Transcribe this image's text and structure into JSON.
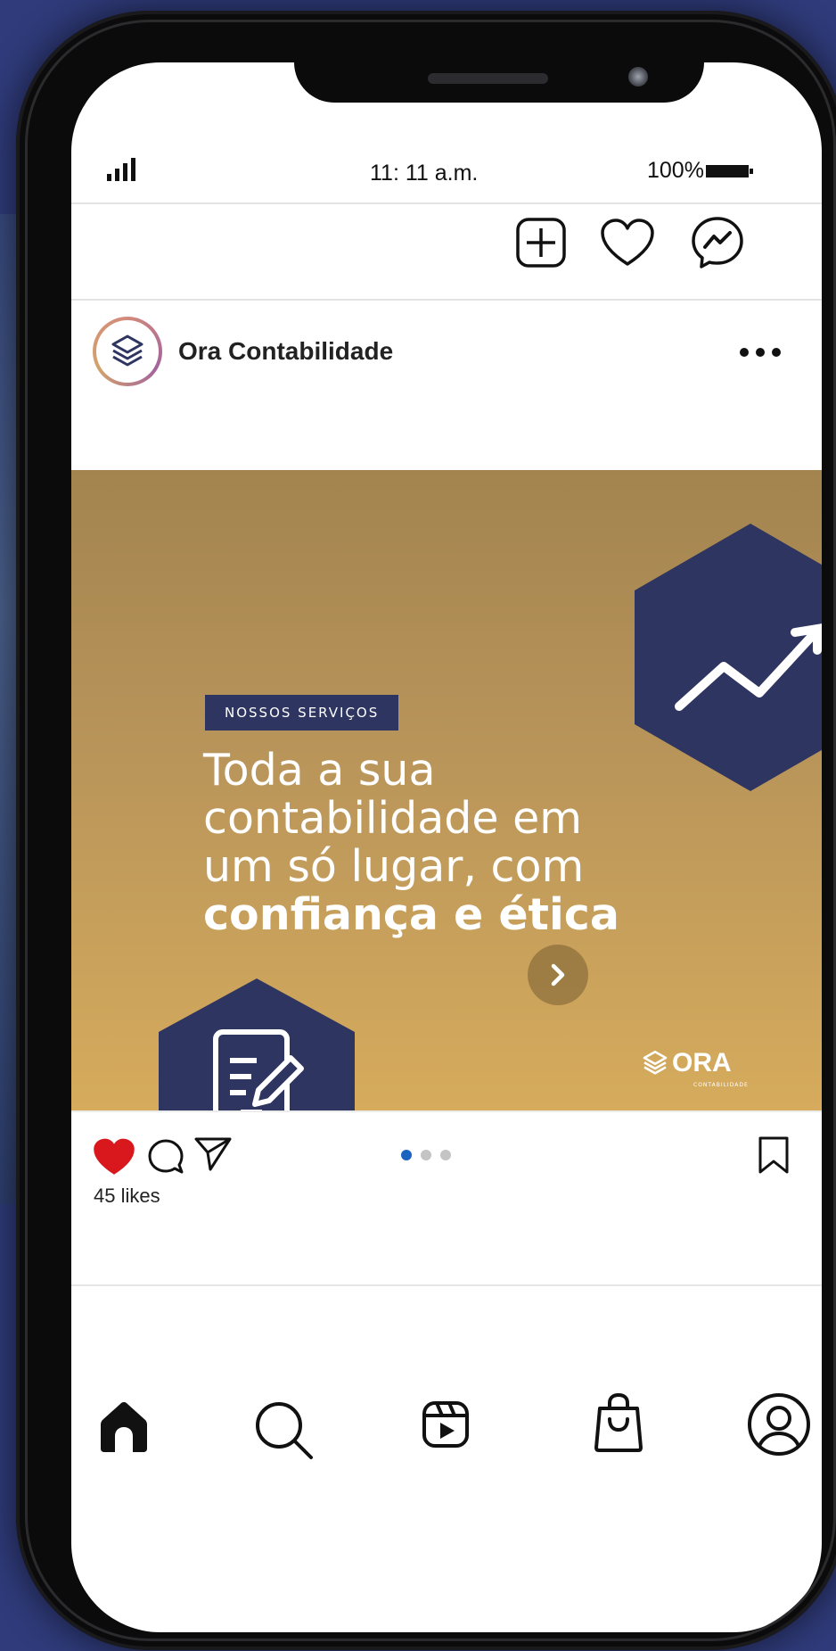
{
  "status_bar": {
    "time": "11: 11 a.m.",
    "battery": "100%"
  },
  "top_actions": {
    "icons": [
      "add-post-icon",
      "heart-icon",
      "messenger-icon"
    ]
  },
  "post": {
    "username": "Ora Contabilidade",
    "badge": "NOSSOS SERVIÇOS",
    "headline_lines": [
      "Toda a sua",
      "contabilidade em",
      "um só lugar, com"
    ],
    "headline_bold": "confiança e ética",
    "brand_logo": "ORA",
    "brand_sub": "CONTABILIDADE",
    "likes": "45 likes",
    "liked": true,
    "carousel_total": 3,
    "carousel_active": 1
  },
  "bottom_nav": {
    "items": [
      "home-icon",
      "search-icon",
      "reels-icon",
      "shop-icon",
      "profile-icon"
    ]
  },
  "colors": {
    "navy": "#2e3560",
    "gold_top": "#a3844f",
    "gold_bottom": "#d6ab5c",
    "like_red": "#d9181e",
    "active_dot": "#1a64c0",
    "background": "#2f3b7a"
  }
}
